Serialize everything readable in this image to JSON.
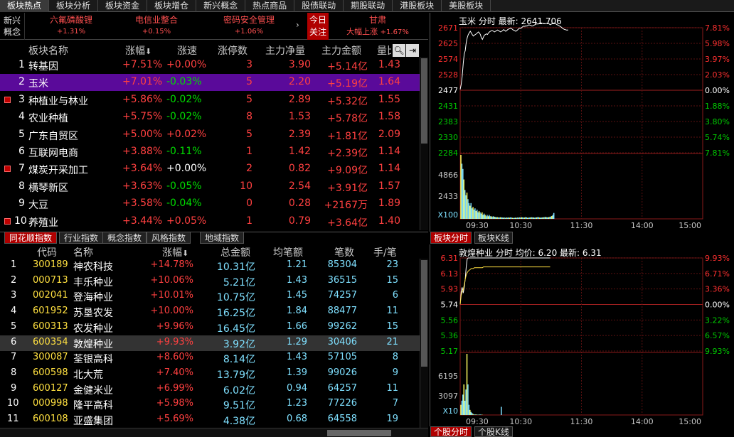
{
  "top_tabs": [
    "板块热点",
    "板块分析",
    "板块资金",
    "板块增仓",
    "新兴概念",
    "热点商品",
    "股债联动",
    "期股联动",
    "港股板块",
    "美股板块"
  ],
  "hot": {
    "category": [
      "新兴",
      "概念"
    ],
    "items": [
      {
        "name": "六氟磷酸锂",
        "chg": "+1.31%"
      },
      {
        "name": "电信业整合",
        "chg": "+0.15%"
      },
      {
        "name": "密码安全管理",
        "chg": "+1.06%"
      }
    ],
    "arrow": "›",
    "today": [
      "今日",
      "关注"
    ],
    "gansu": {
      "title": "甘肃",
      "sub": "大幅上涨",
      "chg": "+1.67%"
    }
  },
  "sector": {
    "headers": {
      "name": "板块名称",
      "chg": "涨幅",
      "speed": "涨速",
      "up": "涨停数",
      "net": "主力净量",
      "amount": "主力金额",
      "vol": "量比"
    },
    "rows": [
      {
        "no": "1",
        "name": "转基因",
        "chg": "+7.51%",
        "speed": "+0.00%",
        "up": "3",
        "net": "3.90",
        "amount": "+5.14亿",
        "vol": "1.43",
        "plus": false
      },
      {
        "no": "2",
        "name": "玉米",
        "chg": "+7.01%",
        "speed": "-0.03%",
        "up": "5",
        "net": "2.20",
        "amount": "+5.19亿",
        "vol": "1.64",
        "plus": false
      },
      {
        "no": "3",
        "name": "种植业与林业",
        "chg": "+5.86%",
        "speed": "-0.02%",
        "up": "5",
        "net": "2.89",
        "amount": "+5.32亿",
        "vol": "1.55",
        "plus": true
      },
      {
        "no": "4",
        "name": "农业种植",
        "chg": "+5.75%",
        "speed": "-0.02%",
        "up": "8",
        "net": "1.53",
        "amount": "+5.78亿",
        "vol": "1.58",
        "plus": false
      },
      {
        "no": "5",
        "name": "广东自贸区",
        "chg": "+5.00%",
        "speed": "+0.02%",
        "up": "5",
        "net": "2.39",
        "amount": "+1.81亿",
        "vol": "2.09",
        "plus": false
      },
      {
        "no": "6",
        "name": "互联网电商",
        "chg": "+3.88%",
        "speed": "-0.11%",
        "up": "1",
        "net": "1.42",
        "amount": "+2.39亿",
        "vol": "1.14",
        "plus": false
      },
      {
        "no": "7",
        "name": "煤炭开采加工",
        "chg": "+3.64%",
        "speed": "+0.00%",
        "up": "2",
        "net": "0.82",
        "amount": "+9.09亿",
        "vol": "1.14",
        "plus": true
      },
      {
        "no": "8",
        "name": "横琴新区",
        "chg": "+3.63%",
        "speed": "-0.05%",
        "up": "10",
        "net": "2.54",
        "amount": "+3.91亿",
        "vol": "1.57",
        "plus": false
      },
      {
        "no": "9",
        "name": "大豆",
        "chg": "+3.58%",
        "speed": "-0.04%",
        "up": "0",
        "net": "0.28",
        "amount": "+2167万",
        "vol": "1.89",
        "plus": false
      },
      {
        "no": "10",
        "name": "养殖业",
        "chg": "+3.44%",
        "speed": "+0.05%",
        "up": "1",
        "net": "0.79",
        "amount": "+3.64亿",
        "vol": "1.40",
        "plus": true
      }
    ]
  },
  "index_tabs": [
    "同花顺指数",
    "行业指数",
    "概念指数",
    "风格指数",
    "地域指数"
  ],
  "stocks": {
    "headers": {
      "code": "代码",
      "name": "名称",
      "chg": "涨幅",
      "amount": "总金额",
      "avg": "均笔额",
      "count": "笔数",
      "hand": "手/笔"
    },
    "rows": [
      {
        "no": "1",
        "code": "300189",
        "name": "神农科技",
        "chg": "+14.78%",
        "amount": "10.31亿",
        "avg": "1.21",
        "count": "85304",
        "hand": "23"
      },
      {
        "no": "2",
        "code": "000713",
        "name": "丰乐种业",
        "chg": "+10.06%",
        "amount": "5.21亿",
        "avg": "1.43",
        "count": "36515",
        "hand": "15"
      },
      {
        "no": "3",
        "code": "002041",
        "name": "登海种业",
        "chg": "+10.01%",
        "amount": "10.75亿",
        "avg": "1.45",
        "count": "74257",
        "hand": "6"
      },
      {
        "no": "4",
        "code": "601952",
        "name": "苏垦农发",
        "chg": "+10.00%",
        "amount": "16.25亿",
        "avg": "1.84",
        "count": "88477",
        "hand": "11"
      },
      {
        "no": "5",
        "code": "600313",
        "name": "农发种业",
        "chg": "+9.96%",
        "amount": "16.45亿",
        "avg": "1.66",
        "count": "99262",
        "hand": "15"
      },
      {
        "no": "6",
        "code": "600354",
        "name": "敦煌种业",
        "chg": "+9.93%",
        "amount": "3.92亿",
        "avg": "1.29",
        "count": "30406",
        "hand": "21"
      },
      {
        "no": "7",
        "code": "300087",
        "name": "荃银高科",
        "chg": "+8.60%",
        "amount": "8.14亿",
        "avg": "1.43",
        "count": "57105",
        "hand": "8"
      },
      {
        "no": "8",
        "code": "600598",
        "name": "北大荒",
        "chg": "+7.40%",
        "amount": "13.79亿",
        "avg": "1.39",
        "count": "99026",
        "hand": "9"
      },
      {
        "no": "9",
        "code": "600127",
        "name": "金健米业",
        "chg": "+6.99%",
        "amount": "6.02亿",
        "avg": "0.94",
        "count": "64257",
        "hand": "11"
      },
      {
        "no": "10",
        "code": "000998",
        "name": "隆平高科",
        "chg": "+5.98%",
        "amount": "9.51亿",
        "avg": "1.23",
        "count": "77226",
        "hand": "7"
      },
      {
        "no": "11",
        "code": "600108",
        "name": "亚盛集团",
        "chg": "+5.69%",
        "amount": "4.38亿",
        "avg": "0.68",
        "count": "64558",
        "hand": "19"
      }
    ]
  },
  "chart1": {
    "title": "玉米 分时 最新: 2641.706",
    "tab_active": "板块分时",
    "tab_other": "板块K线",
    "prices": [
      "2671",
      "2625",
      "2574",
      "2528",
      "2477",
      "2431",
      "2383",
      "2330",
      "2284"
    ],
    "pcts": [
      "7.81%",
      "5.98%",
      "3.97%",
      "2.03%",
      "0.00%",
      "1.88%",
      "3.80%",
      "5.74%",
      "7.81%"
    ],
    "vol_labels": [
      "4866",
      "2433",
      "X100"
    ],
    "times": [
      "09:30",
      "10:30",
      "11:30",
      "14:00",
      "15:00"
    ],
    "prev_close": 2477,
    "ymin": 2284,
    "ymax": 2671,
    "line": [
      2480,
      2495,
      2520,
      2560,
      2590,
      2600,
      2625,
      2640,
      2650,
      2655,
      2660,
      2655,
      2650,
      2645,
      2648,
      2650,
      2652,
      2655,
      2658,
      2655,
      2650,
      2640,
      2635,
      2642,
      2648,
      2650,
      2652,
      2650,
      2655,
      2658,
      2660,
      2662,
      2662,
      2660,
      2658,
      2660,
      2662,
      2664,
      2662,
      2660,
      2658,
      2660,
      2662,
      2665,
      2663,
      2660,
      2662,
      2665,
      2667,
      2668,
      2670,
      2668,
      2665,
      2663,
      2662,
      2660,
      2662,
      2665,
      2668,
      2670,
      2669,
      2672,
      2674,
      2676,
      2675,
      2677,
      2676,
      2678,
      2680,
      2679,
      2678,
      2676,
      2677,
      2679,
      2680,
      2682,
      2683,
      2682,
      2684,
      2685,
      2686,
      2685,
      2684,
      2683,
      2683,
      2684,
      2685,
      2684,
      2683,
      2680,
      2682,
      2683,
      2684,
      2686,
      2684,
      2682,
      2680,
      2679,
      2677,
      2675,
      2673,
      2670,
      2668,
      2666,
      2665,
      2664,
      2664,
      2664
    ],
    "vol": [
      48.7,
      42,
      38,
      30,
      22,
      18,
      20,
      15,
      12,
      10,
      12,
      8,
      9,
      7,
      8,
      6,
      7,
      5,
      6,
      5,
      4,
      5,
      3,
      4,
      3,
      2,
      3,
      2,
      3,
      2,
      2,
      1.5,
      2,
      1.6,
      1.4,
      1.2,
      1.3,
      1.1,
      1,
      1.2,
      1.1,
      1,
      0.9,
      1,
      0.8,
      1,
      0.9,
      1,
      0.9,
      1.1,
      1,
      0.8,
      0.7,
      0.8,
      0.9,
      0.8,
      1,
      0.9,
      1.1,
      1,
      1.2,
      1.1,
      0.9,
      1,
      1.3,
      1.1,
      0.8,
      0.9,
      1,
      1.1,
      1.2,
      1.1,
      1,
      0.9,
      1,
      1.1,
      1.3,
      1.2,
      1,
      0.9,
      1,
      1.1,
      1.2,
      1.3,
      1.4,
      1.2,
      1.1,
      1.3,
      1.5,
      1.8,
      2.2,
      3,
      4.5
    ]
  },
  "chart2": {
    "title": "敦煌种业 分时 均价: 6.20 最新: 6.31",
    "tab_active": "个股分时",
    "tab_other": "个股K线",
    "prices": [
      "6.31",
      "6.13",
      "5.93",
      "5.74",
      "5.56",
      "5.36",
      "5.17"
    ],
    "pcts": [
      "9.93%",
      "6.71%",
      "3.36%",
      "0.00%",
      "3.22%",
      "6.57%",
      "9.93%"
    ],
    "vol_labels": [
      "6195",
      "3097",
      "X10"
    ],
    "times": [
      "09:30",
      "10:30",
      "11:30",
      "14:00",
      "15:00"
    ],
    "prev_close": 5.74,
    "ymin": 5.17,
    "ymax": 6.31,
    "line": [
      5.74,
      5.9,
      5.95,
      5.88,
      5.95,
      6.05,
      6.2,
      6.3,
      6.31,
      6.31,
      6.31,
      6.31,
      6.31,
      6.31,
      6.31,
      6.31,
      6.31,
      6.31,
      6.31,
      6.31,
      6.31,
      6.31,
      6.31,
      6.31,
      6.31,
      6.31,
      6.31,
      6.31,
      6.31,
      6.31,
      6.31,
      6.31,
      6.31,
      6.31,
      6.31,
      6.31,
      6.31,
      6.31,
      6.31,
      6.31,
      6.31,
      6.31,
      6.31,
      6.31,
      6.31,
      6.31,
      6.31,
      6.31,
      6.31,
      6.31,
      6.31,
      6.31,
      6.31,
      6.31,
      6.31,
      6.31,
      6.31,
      6.31,
      6.31,
      6.31,
      6.31,
      6.31,
      6.31,
      6.31,
      6.31,
      6.31,
      6.31,
      6.31,
      6.31,
      6.31,
      6.31,
      6.31,
      6.31,
      6.31,
      6.31,
      6.31,
      6.31,
      6.31,
      6.31,
      6.31,
      6.31,
      6.31,
      6.31,
      6.31,
      6.31,
      6.31,
      6.31,
      6.31,
      6.31,
      6.31
    ],
    "avgline": [
      5.74,
      5.85,
      5.9,
      5.92,
      5.98,
      6.05,
      6.1,
      6.13,
      6.15,
      6.16,
      6.17,
      6.18,
      6.18,
      6.18,
      6.19,
      6.19,
      6.19,
      6.19,
      6.19,
      6.19,
      6.19,
      6.19,
      6.19,
      6.2,
      6.2,
      6.2,
      6.2,
      6.2,
      6.2,
      6.2,
      6.2,
      6.2,
      6.2,
      6.2,
      6.2,
      6.2,
      6.2,
      6.2,
      6.2,
      6.2,
      6.2,
      6.2,
      6.2,
      6.2,
      6.2,
      6.2,
      6.2,
      6.2,
      6.2,
      6.2,
      6.2,
      6.2,
      6.2,
      6.2,
      6.2,
      6.2,
      6.2,
      6.2,
      6.2,
      6.2,
      6.2,
      6.2,
      6.2,
      6.2,
      6.2,
      6.2,
      6.2,
      6.2,
      6.2,
      6.2,
      6.2,
      6.2,
      6.2,
      6.2,
      6.2,
      6.2,
      6.2,
      6.2,
      6.2,
      6.2,
      6.2,
      6.2,
      6.2,
      6.2,
      6.2,
      6.2,
      6.2,
      6.2,
      6.2,
      6.2
    ],
    "vol": [
      10,
      14,
      20,
      30,
      14,
      25,
      60,
      30,
      10,
      5,
      3,
      2,
      1,
      0.5,
      0.5,
      0.5,
      0.3,
      0.3,
      0.3,
      0.5,
      0.3,
      0.3,
      0,
      0,
      0,
      0,
      0,
      0,
      0,
      0,
      0,
      0,
      0,
      0,
      0,
      0,
      0,
      0,
      0,
      0,
      8,
      0,
      0,
      0,
      0,
      0,
      0,
      0,
      0,
      0,
      0,
      0,
      0,
      0,
      0,
      0,
      0,
      0,
      0,
      0,
      0,
      0,
      0,
      0,
      0,
      0,
      0,
      0,
      0,
      0,
      0,
      0,
      0,
      0,
      0,
      0,
      0,
      0,
      0,
      0,
      0,
      0,
      0,
      0,
      0,
      0,
      0,
      0,
      0,
      0
    ]
  },
  "colors": {
    "up": "#ff4040",
    "down": "#00dd00",
    "price_line": "#ffffff",
    "avg_line": "#ffe040",
    "axis_red": "#ff3030",
    "axis_green": "#00c800"
  }
}
